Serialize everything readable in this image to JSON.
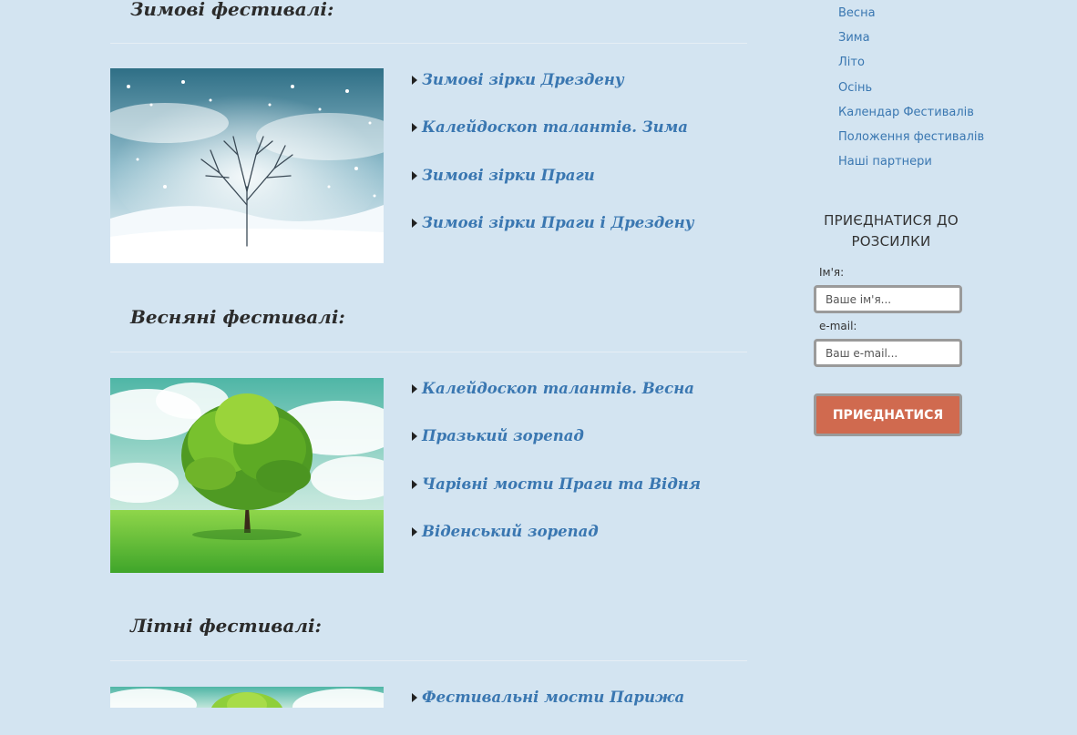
{
  "sections": [
    {
      "title": "Зимові фестивалі:",
      "image": "winter-tree-snow",
      "festivals": [
        "Зимові зірки Дрездену",
        "Калейдоскоп талантів. Зима",
        "Зимові зірки Праги",
        "Зимові зірки Праги і Дрездену"
      ]
    },
    {
      "title": "Весняні фестивалі:",
      "image": "spring-tree-meadow",
      "festivals": [
        "Калейдоскоп талантів. Весна",
        "Празький зорепад",
        "Чарівні мости Праги та Відня",
        "Віденський зорепад"
      ]
    },
    {
      "title": "Літні фестивалі:",
      "image": "summer-tree-meadow",
      "festivals": [
        "Фестивальні мости Парижа"
      ]
    }
  ],
  "sidebar": {
    "menu": [
      "Весна",
      "Зима",
      "Літо",
      "Осінь",
      "Календар Фестивалів",
      "Положення фестивалів",
      "Наші партнери"
    ],
    "newsletter": {
      "title": "ПРИЄДНАТИСЯ ДО РОЗСИЛКИ",
      "name_label": "Ім'я:",
      "name_placeholder": "Ваше ім'я...",
      "email_label": "e-mail:",
      "email_placeholder": "Ваш e-mail...",
      "button": "ПРИЄДНАТИСЯ"
    }
  },
  "colors": {
    "background": "#d3e4f1",
    "link": "#3a77b1",
    "button": "#d06a4f"
  }
}
